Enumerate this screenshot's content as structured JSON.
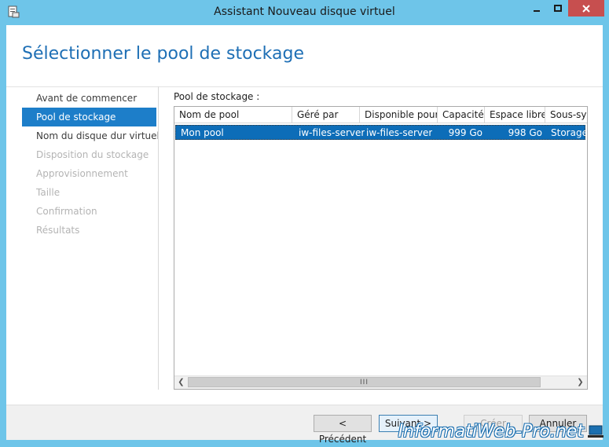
{
  "window": {
    "title": "Assistant Nouveau disque virtuel"
  },
  "page": {
    "title": "Sélectionner le pool de stockage"
  },
  "nav": {
    "items": [
      {
        "label": "Avant de commencer",
        "state": "normal"
      },
      {
        "label": "Pool de stockage",
        "state": "active"
      },
      {
        "label": "Nom du disque dur virtuel",
        "state": "normal"
      },
      {
        "label": "Disposition du stockage",
        "state": "disabled"
      },
      {
        "label": "Approvisionnement",
        "state": "disabled"
      },
      {
        "label": "Taille",
        "state": "disabled"
      },
      {
        "label": "Confirmation",
        "state": "disabled"
      },
      {
        "label": "Résultats",
        "state": "disabled"
      }
    ]
  },
  "pool_section": {
    "label": "Pool de stockage :",
    "columns": [
      "Nom de pool",
      "Géré par",
      "Disponible pour",
      "Capacité",
      "Espace libre",
      "Sous-sys"
    ],
    "rows": [
      {
        "cells": [
          "Mon pool",
          "iw-files-server",
          "iw-files-server",
          "999 Go",
          "998 Go",
          "Storage"
        ],
        "selected": true
      }
    ]
  },
  "footer": {
    "previous_label": "< Précédent",
    "next_label": "Suivant >",
    "create_label": "Créer",
    "cancel_label": "Annuler"
  },
  "watermark": {
    "text": "InformatiWeb-Pro.net"
  },
  "colors": {
    "title_blue": "#1e6fb5",
    "selection_blue": "#0d6db8",
    "titlebar": "#6ec5e9",
    "close_red": "#c74f4f"
  }
}
